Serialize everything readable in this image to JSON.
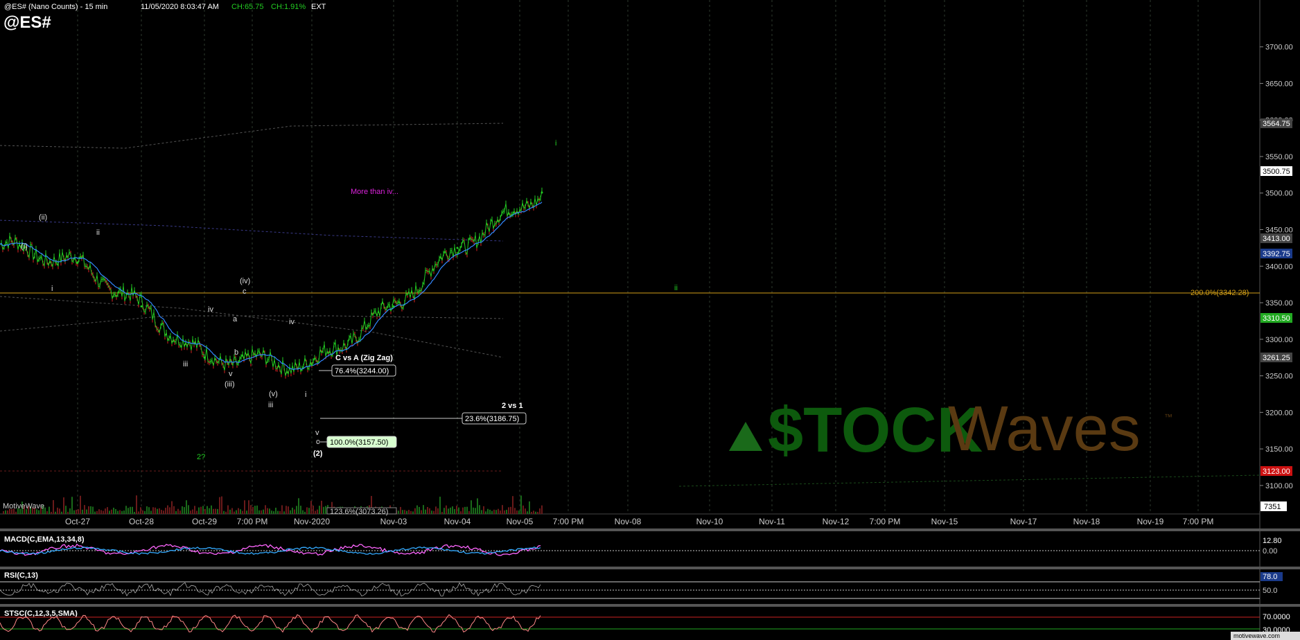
{
  "header": {
    "symbol_title": "@ES# (Nano Counts) - 15 min",
    "datetime": "11/05/2020 8:03:47 AM",
    "change_abs": "CH:65.75",
    "change_pct": "CH:1.91%",
    "session": "EXT",
    "symbol": "@ES#"
  },
  "colors": {
    "background": "#000000",
    "up_bar": "#22cc22",
    "down_bar": "#dd2222",
    "ma_line": "#3388ff",
    "level_line": "#d4a017",
    "green_label": "#22cc22",
    "magenta_text": "#dd22dd",
    "price_badge_green": "#22aa22",
    "price_badge_red": "#cc1111",
    "price_badge_blue": "#1a3a8a"
  },
  "price_axis": {
    "ticks": [
      "3700.00",
      "3650.00",
      "3600.00",
      "3550.00",
      "3500.00",
      "3450.00",
      "3400.00",
      "3350.00",
      "3300.00",
      "3250.00",
      "3200.00",
      "3150.00",
      "3100.00"
    ],
    "badges": [
      {
        "text": "3564.75",
        "style": "gray"
      },
      {
        "text": "3500.75",
        "style": "white"
      },
      {
        "text": "3413.00",
        "style": "gray"
      },
      {
        "text": "3392.75",
        "style": "blue"
      },
      {
        "text": "3310.50",
        "style": "green"
      },
      {
        "text": "3261.25",
        "style": "gray"
      },
      {
        "text": "3123.00",
        "style": "red"
      },
      {
        "text": "7351",
        "style": "white"
      }
    ]
  },
  "time_axis": {
    "labels": [
      "Oct-27",
      "Oct-28",
      "Oct-29",
      "7:00 PM",
      "Nov-2020",
      "Nov-03",
      "Nov-04",
      "Nov-05",
      "7:00 PM",
      "Nov-08",
      "Nov-10",
      "Nov-11",
      "Nov-12",
      "7:00 PM",
      "Nov-15",
      "Nov-17",
      "Nov-18",
      "Nov-19",
      "7:00 PM"
    ]
  },
  "wave_labels": [
    "(ii)",
    "(i)",
    "ii",
    "i",
    "(iv)",
    "c",
    "iv",
    "a",
    "iii",
    "b",
    "v",
    "(iii)",
    "iv",
    "(v)",
    "iii",
    "i",
    "v",
    "c",
    "(2)",
    "2?",
    "i",
    "ii"
  ],
  "annotations": {
    "more_than_iv": "More than iv...",
    "c_vs_a": "C vs A (Zig Zag)",
    "fib_764": "76.4%(3244.00)",
    "two_vs_one": "2 vs 1",
    "fib_236": "23.6%(3186.75)",
    "fib_100": "100.0%(3157.50)",
    "fib_1236": "123.6%(3073.26)",
    "fib_200": "200.0%(3342.28)",
    "motivewave": "MotiveWave",
    "watermark_stock": "$TOCK",
    "watermark_waves": "Waves",
    "watermark_tm": "™"
  },
  "indicators": {
    "macd": {
      "label": "MACD(C,EMA,13,34,8)",
      "value": "12.80",
      "zero": "0.00"
    },
    "rsi": {
      "label": "RSI(C,13)",
      "value": "78.0",
      "level": "50.0"
    },
    "stsc": {
      "label": "STSC(C,12,3,5,SMA)",
      "upper": "70.0000",
      "lower": "30.0000"
    }
  },
  "footer": {
    "site": "motivewave.com"
  },
  "chart_data": {
    "type": "line",
    "title": "@ES# (Nano Counts) - 15 min",
    "x": [
      "Oct-27",
      "Oct-28",
      "Oct-29",
      "Nov-2020",
      "Nov-03",
      "Nov-04",
      "Nov-05"
    ],
    "series": [
      {
        "values": [
          3405,
          3345,
          3275,
          3265,
          3345,
          3425,
          3500.75
        ]
      }
    ],
    "ylim": [
      3080,
      3730
    ],
    "reference_levels": [
      3342.28,
      3244.0,
      3186.75,
      3157.5
    ],
    "grid": true
  }
}
